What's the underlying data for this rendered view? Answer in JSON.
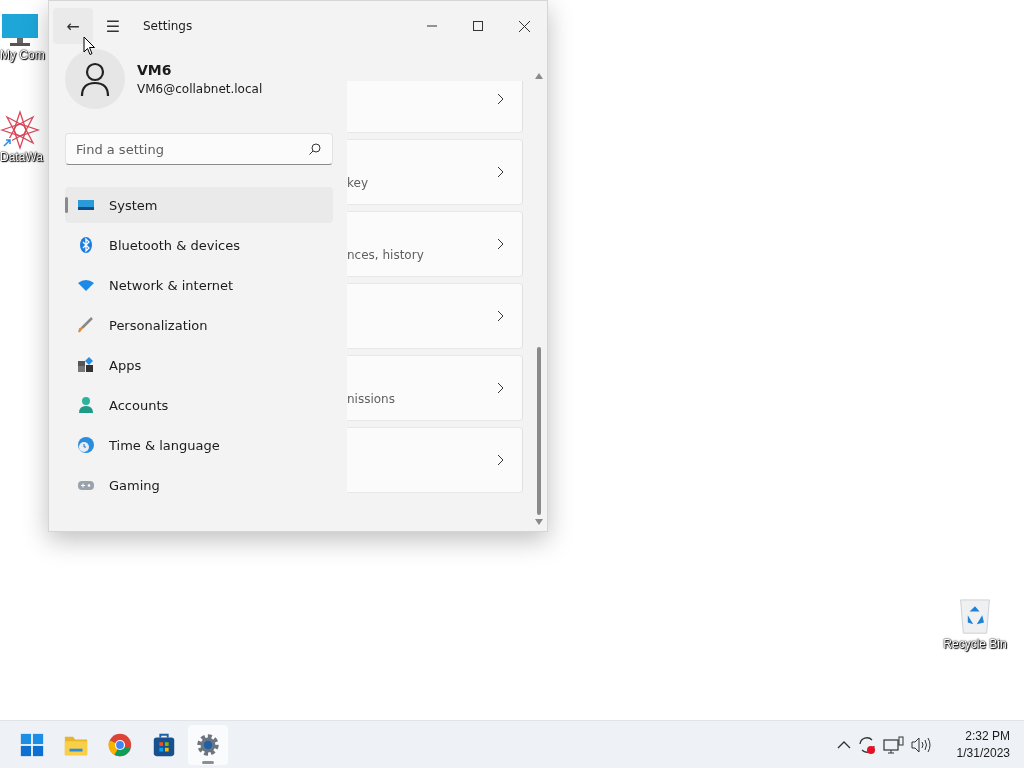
{
  "desktop_icons": [
    {
      "kind": "computer",
      "label": "My Com"
    },
    {
      "kind": "app",
      "label": "DataWa"
    },
    {
      "kind": "recycle",
      "label": "Recycle Bin"
    }
  ],
  "window": {
    "title": "Settings",
    "back": "←",
    "menu": "☰"
  },
  "account": {
    "name": "VM6",
    "email": "VM6@collabnet.local"
  },
  "search": {
    "placeholder": "Find a setting"
  },
  "nav": [
    {
      "kind": "system",
      "label": "System",
      "selected": true
    },
    {
      "kind": "bluetooth",
      "label": "Bluetooth & devices",
      "selected": false
    },
    {
      "kind": "network",
      "label": "Network & internet",
      "selected": false
    },
    {
      "kind": "brush",
      "label": "Personalization",
      "selected": false
    },
    {
      "kind": "apps",
      "label": "Apps",
      "selected": false
    },
    {
      "kind": "accounts",
      "label": "Accounts",
      "selected": false
    },
    {
      "kind": "time",
      "label": "Time & language",
      "selected": false
    },
    {
      "kind": "gaming",
      "label": "Gaming",
      "selected": false
    }
  ],
  "cards": [
    {
      "kind": "partial"
    },
    {
      "kind": "full",
      "subtitle": "key"
    },
    {
      "kind": "full",
      "subtitle": "nces, history"
    },
    {
      "kind": "full"
    },
    {
      "kind": "full",
      "subtitle": "nissions"
    },
    {
      "kind": "full"
    }
  ],
  "taskbar": {
    "apps": [
      {
        "kind": "start",
        "selected": false
      },
      {
        "kind": "folder",
        "selected": false
      },
      {
        "kind": "chrome",
        "selected": false
      },
      {
        "kind": "store",
        "selected": false
      },
      {
        "kind": "settings",
        "selected": true
      }
    ],
    "time": "2:32 PM",
    "date": "1/31/2023"
  }
}
